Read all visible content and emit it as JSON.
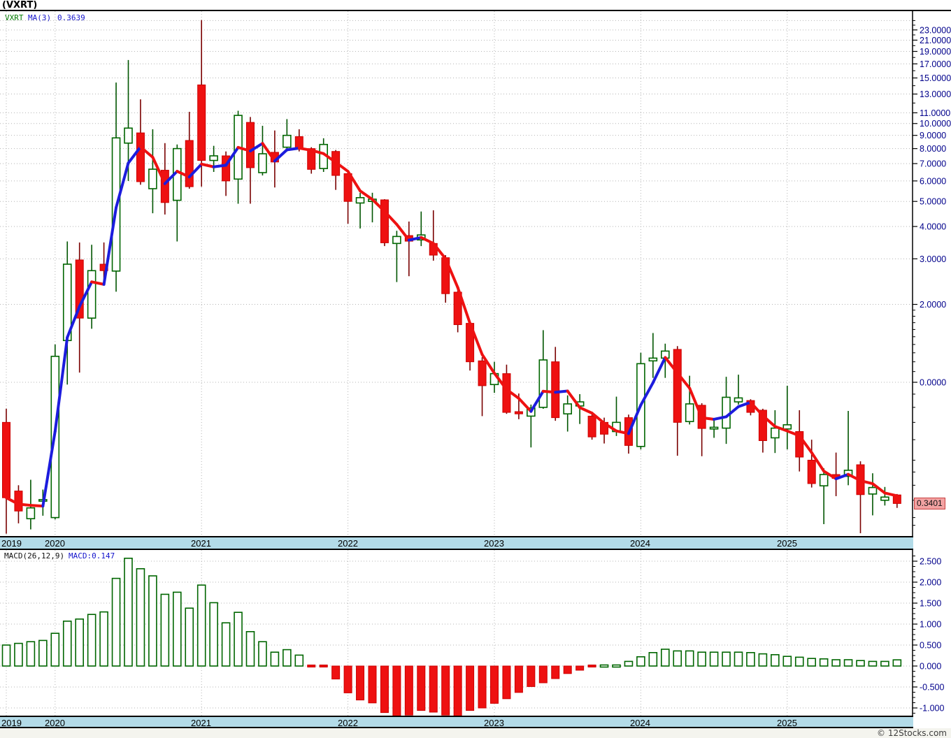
{
  "title": "(VXRT)",
  "legend": {
    "symbol": "VXRT",
    "ma_label": "MA(3)",
    "ma_value": "0.3639"
  },
  "macd_legend": {
    "label": "MACD(26,12,9)",
    "value_label": "MACD:0.147"
  },
  "last_price_label": "0.3401",
  "copyright": "© 12Stocks.com",
  "colors": {
    "bull_outline": "#006600",
    "bull_wick": "#005500",
    "bear_fill": "#ee1111",
    "bear_border": "#cc0000",
    "bear_wick": "#7a0000",
    "ma_up": "#1c1cdd",
    "ma_down": "#ee1111",
    "grid": "#b4b4b4",
    "axis_line": "#000000",
    "axis_text": "#00008b",
    "band_bg": "#b3dbe8",
    "price_tag_bg": "#f2a2a2"
  },
  "axis": {
    "years": [
      "2019",
      "2020",
      "2021",
      "2022",
      "2023",
      "2024",
      "2025"
    ],
    "price_ticks": [
      {
        "label": "23.0000",
        "value": 23
      },
      {
        "label": "21.0000",
        "value": 21
      },
      {
        "label": "19.0000",
        "value": 19
      },
      {
        "label": "17.0000",
        "value": 17
      },
      {
        "label": "15.0000",
        "value": 15
      },
      {
        "label": "13.0000",
        "value": 13
      },
      {
        "label": "11.0000",
        "value": 11
      },
      {
        "label": "10.0000",
        "value": 10
      },
      {
        "label": "9.0000",
        "value": 9
      },
      {
        "label": "8.0000",
        "value": 8
      },
      {
        "label": "7.0000",
        "value": 7
      },
      {
        "label": "6.0000",
        "value": 6
      },
      {
        "label": "5.0000",
        "value": 5
      },
      {
        "label": "4.0000",
        "value": 4
      },
      {
        "label": "3.0000",
        "value": 3
      },
      {
        "label": "2.0000",
        "value": 2
      },
      {
        "label": "0.0000",
        "value": 1
      }
    ],
    "macd_ticks": [
      {
        "label": "2.500",
        "value": 2.5
      },
      {
        "label": "2.000",
        "value": 2.0
      },
      {
        "label": "1.500",
        "value": 1.5
      },
      {
        "label": "1.000",
        "value": 1.0
      },
      {
        "label": "0.500",
        "value": 0.5
      },
      {
        "label": "0.000",
        "value": 0.0
      },
      {
        "label": "-0.500",
        "value": -0.5
      },
      {
        "label": "-1.000",
        "value": -1.0
      }
    ]
  },
  "chart_data": [
    {
      "type": "candlestick",
      "title": "VXRT monthly candlesticks with MA(3) overlay",
      "y_scale": "log",
      "interval": "monthly",
      "start_month": "2019-09",
      "ma_period": 3,
      "last_close": 0.3401,
      "columns": [
        "open",
        "high",
        "low",
        "close"
      ],
      "candles": [
        [
          0.7,
          0.79,
          0.26,
          0.358
        ],
        [
          0.38,
          0.4,
          0.285,
          0.318
        ],
        [
          0.297,
          0.42,
          0.27,
          0.327
        ],
        [
          0.35,
          0.385,
          0.305,
          0.352
        ],
        [
          0.3,
          1.4,
          0.295,
          1.26
        ],
        [
          1.45,
          3.5,
          0.98,
          2.86
        ],
        [
          2.97,
          3.47,
          1.09,
          1.77
        ],
        [
          1.77,
          3.4,
          1.61,
          2.7
        ],
        [
          2.86,
          3.47,
          2.39,
          2.7
        ],
        [
          2.69,
          14.4,
          2.24,
          8.8
        ],
        [
          8.4,
          17.6,
          6.0,
          9.6
        ],
        [
          9.2,
          12.4,
          5.8,
          5.96
        ],
        [
          5.6,
          9.5,
          4.5,
          6.66
        ],
        [
          6.6,
          8.4,
          4.45,
          4.95
        ],
        [
          5.05,
          8.3,
          3.5,
          8.0
        ],
        [
          8.6,
          11.1,
          5.6,
          5.7
        ],
        [
          14.1,
          25.1,
          5.7,
          7.2
        ],
        [
          7.2,
          8.2,
          6.5,
          7.5
        ],
        [
          7.5,
          7.8,
          5.25,
          6.0
        ],
        [
          6.1,
          11.2,
          4.9,
          10.75
        ],
        [
          10.1,
          10.6,
          4.9,
          6.75
        ],
        [
          6.46,
          9.8,
          6.3,
          7.64
        ],
        [
          7.74,
          9.4,
          5.66,
          7.1
        ],
        [
          8.1,
          10.4,
          7.8,
          9.0
        ],
        [
          8.9,
          9.5,
          7.8,
          8.0
        ],
        [
          8.0,
          8.1,
          6.4,
          6.65
        ],
        [
          6.7,
          8.77,
          6.5,
          8.3
        ],
        [
          7.8,
          7.9,
          5.54,
          6.3
        ],
        [
          6.4,
          6.5,
          4.1,
          5.0
        ],
        [
          4.93,
          5.4,
          3.93,
          5.17
        ],
        [
          5.0,
          5.4,
          4.15,
          5.1
        ],
        [
          5.07,
          5.1,
          3.36,
          3.46
        ],
        [
          3.44,
          3.85,
          2.44,
          3.66
        ],
        [
          3.69,
          4.18,
          2.57,
          3.51
        ],
        [
          3.55,
          4.57,
          3.36,
          3.71
        ],
        [
          3.44,
          4.62,
          2.95,
          3.1
        ],
        [
          3.03,
          3.1,
          2.03,
          2.2
        ],
        [
          2.23,
          2.3,
          1.56,
          1.67
        ],
        [
          1.69,
          1.7,
          1.11,
          1.2
        ],
        [
          1.21,
          1.25,
          0.74,
          0.97
        ],
        [
          0.98,
          1.2,
          0.91,
          1.08
        ],
        [
          1.08,
          1.17,
          0.755,
          0.765
        ],
        [
          0.77,
          0.905,
          0.72,
          0.755
        ],
        [
          0.74,
          0.82,
          0.56,
          0.795
        ],
        [
          0.8,
          1.59,
          0.79,
          1.22
        ],
        [
          1.2,
          1.37,
          0.71,
          0.73
        ],
        [
          0.755,
          0.89,
          0.645,
          0.825
        ],
        [
          0.81,
          0.9,
          0.69,
          0.84
        ],
        [
          0.74,
          0.75,
          0.6,
          0.615
        ],
        [
          0.7,
          0.73,
          0.58,
          0.63
        ],
        [
          0.645,
          0.88,
          0.62,
          0.7
        ],
        [
          0.73,
          0.75,
          0.53,
          0.57
        ],
        [
          0.565,
          1.3,
          0.55,
          1.18
        ],
        [
          1.21,
          1.55,
          1.04,
          1.24
        ],
        [
          1.24,
          1.41,
          1.04,
          1.32
        ],
        [
          1.34,
          1.38,
          0.52,
          0.7
        ],
        [
          0.705,
          1.06,
          0.687,
          0.825
        ],
        [
          0.815,
          0.83,
          0.518,
          0.663
        ],
        [
          0.66,
          0.72,
          0.61,
          0.67
        ],
        [
          0.665,
          1.05,
          0.578,
          0.875
        ],
        [
          0.84,
          1.07,
          0.82,
          0.87
        ],
        [
          0.85,
          0.86,
          0.745,
          0.765
        ],
        [
          0.78,
          0.79,
          0.535,
          0.595
        ],
        [
          0.61,
          0.78,
          0.533,
          0.665
        ],
        [
          0.66,
          0.97,
          0.55,
          0.685
        ],
        [
          0.645,
          0.78,
          0.452,
          0.514
        ],
        [
          0.5,
          0.6,
          0.392,
          0.406
        ],
        [
          0.398,
          0.465,
          0.283,
          0.44
        ],
        [
          0.44,
          0.535,
          0.363,
          0.425
        ],
        [
          0.433,
          0.775,
          0.4,
          0.457
        ],
        [
          0.48,
          0.495,
          0.261,
          0.368
        ],
        [
          0.37,
          0.445,
          0.306,
          0.392
        ],
        [
          0.35,
          0.394,
          0.334,
          0.36
        ],
        [
          0.367,
          0.37,
          0.327,
          0.3401
        ]
      ]
    },
    {
      "type": "bar",
      "title": "MACD(26,12,9) histogram",
      "interval": "monthly",
      "start_month": "2019-09",
      "ylim": [
        -1.25,
        2.78
      ],
      "last_value": 0.147,
      "values": [
        0.5,
        0.54,
        0.58,
        0.61,
        0.78,
        1.07,
        1.12,
        1.23,
        1.29,
        2.09,
        2.57,
        2.32,
        2.15,
        1.71,
        1.76,
        1.38,
        1.93,
        1.51,
        1.03,
        1.28,
        0.82,
        0.58,
        0.33,
        0.39,
        0.26,
        -0.02,
        -0.03,
        -0.31,
        -0.64,
        -0.81,
        -0.88,
        -1.11,
        -1.21,
        -1.17,
        -1.06,
        -1.1,
        -1.17,
        -1.2,
        -1.06,
        -1.0,
        -0.89,
        -0.78,
        -0.63,
        -0.49,
        -0.4,
        -0.3,
        -0.18,
        -0.1,
        -0.04,
        0.01,
        0.02,
        0.11,
        0.22,
        0.32,
        0.4,
        0.36,
        0.36,
        0.33,
        0.33,
        0.33,
        0.33,
        0.32,
        0.29,
        0.27,
        0.23,
        0.21,
        0.18,
        0.17,
        0.15,
        0.15,
        0.13,
        0.11,
        0.11,
        0.147
      ]
    }
  ]
}
